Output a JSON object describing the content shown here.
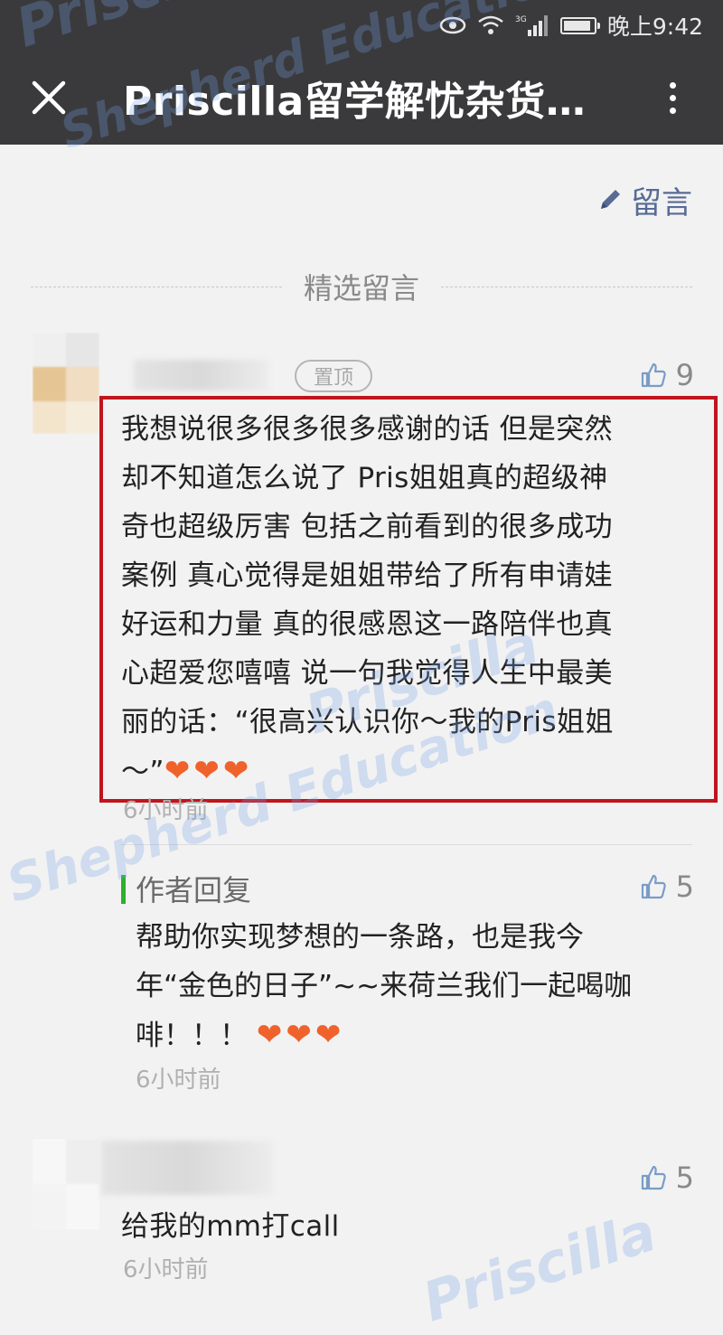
{
  "status_bar": {
    "network": "3G",
    "time": "晚上9:42"
  },
  "header": {
    "title": "Priscilla留学解忧杂货…"
  },
  "write_comment_label": "留言",
  "section_label": "精选留言",
  "comments": [
    {
      "pinned_label": "置顶",
      "likes": "9",
      "text_lines": [
        "我想说很多很多很多感谢的话 但是突然",
        "却不知道怎么说了 Pris姐姐真的超级神",
        "奇也超级厉害 包括之前看到的很多成功",
        "案例 真心觉得是姐姐带给了所有申请娃",
        "好运和力量 真的很感恩这一路陪伴也真",
        "心超爱您嘻嘻 说一句我觉得人生中最美",
        "丽的话：“很高兴认识你～我的Pris姐姐",
        "～”"
      ],
      "hearts": "❤❤❤",
      "time": "6小时前",
      "reply": {
        "label": "作者回复",
        "likes": "5",
        "text_lines": [
          "帮助你实现梦想的一条路，也是我今",
          "年“金色的日子”~~来荷兰我们一起喝咖",
          "啡！！！"
        ],
        "hearts": "❤❤❤",
        "time": "6小时前"
      }
    },
    {
      "likes": "5",
      "text": "给我的mm打call",
      "time": "6小时前"
    }
  ],
  "watermark": {
    "line1": "Priscilla",
    "line2": "Shepherd Education"
  },
  "colors": {
    "topbar": "#3a3a3c",
    "link": "#576b95",
    "highlight_border": "#c0151d",
    "author_bar": "#2bb12b",
    "heart": "#f0622c"
  }
}
